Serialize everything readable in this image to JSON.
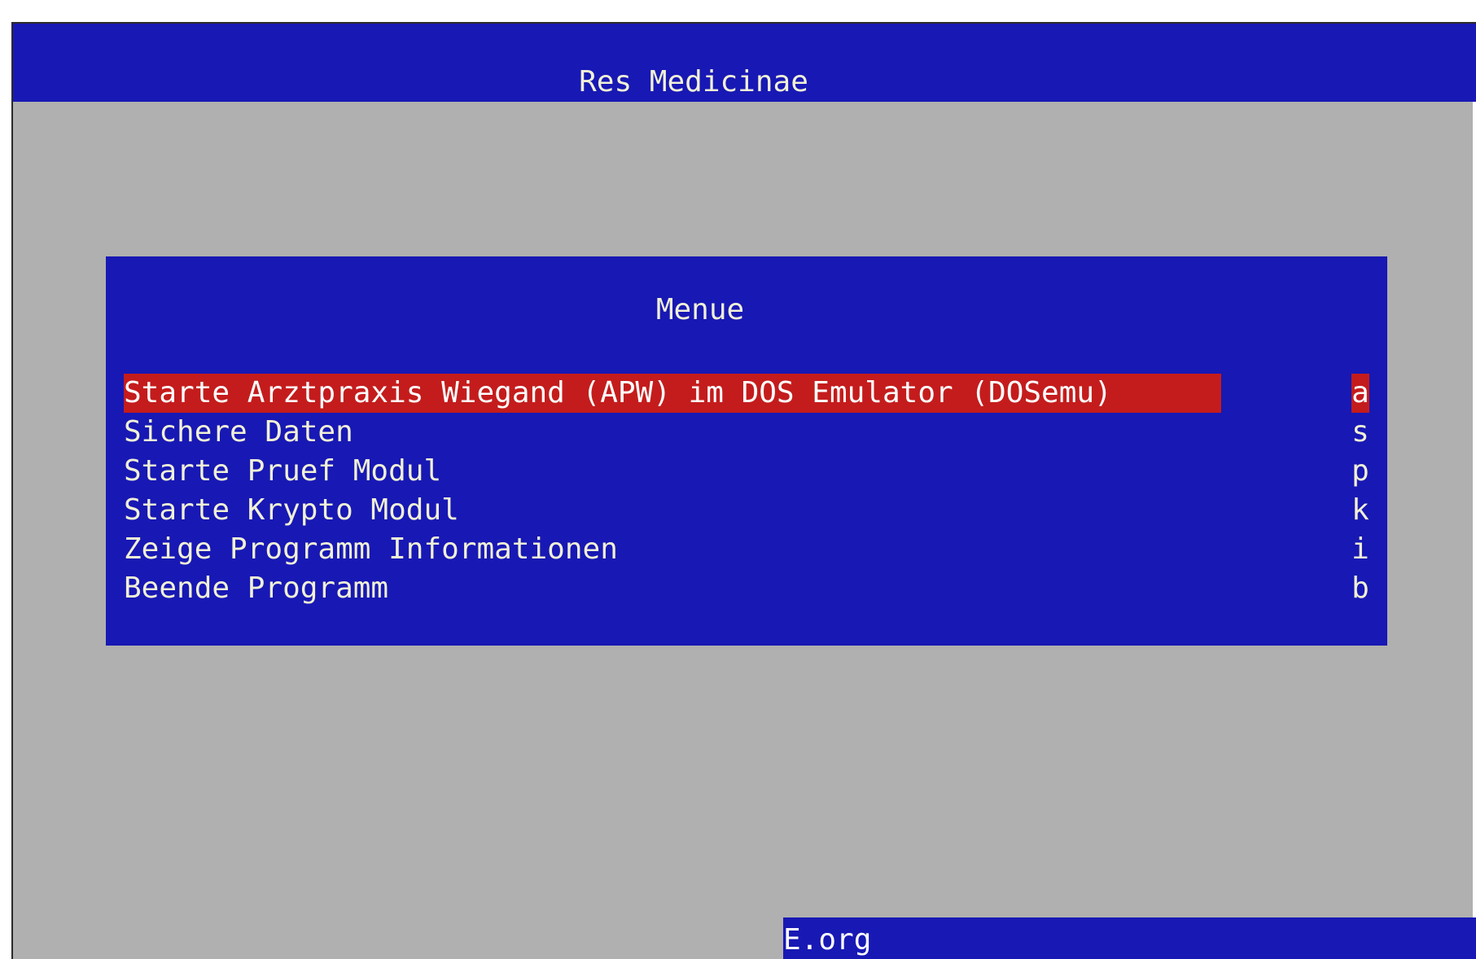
{
  "app": {
    "title": "Res Medicinae"
  },
  "dialog": {
    "title": "Menue",
    "items": [
      {
        "label": "Starte Arztpraxis Wiegand (APW) im DOS Emulator (DOSemu)",
        "key": "a",
        "selected": true
      },
      {
        "label": "Sichere Daten",
        "key": "s",
        "selected": false
      },
      {
        "label": "Starte Pruef Modul",
        "key": "p",
        "selected": false
      },
      {
        "label": "Starte Krypto Modul",
        "key": "k",
        "selected": false
      },
      {
        "label": "Zeige Programm Informationen",
        "key": "i",
        "selected": false
      },
      {
        "label": "Beende Programm",
        "key": "b",
        "selected": false
      }
    ]
  },
  "footer": {
    "text": "E.org"
  },
  "colors": {
    "background": "#b0b0b0",
    "dialog": "#1818b4",
    "highlight": "#c41c1c",
    "text": "#f0f0d6"
  }
}
